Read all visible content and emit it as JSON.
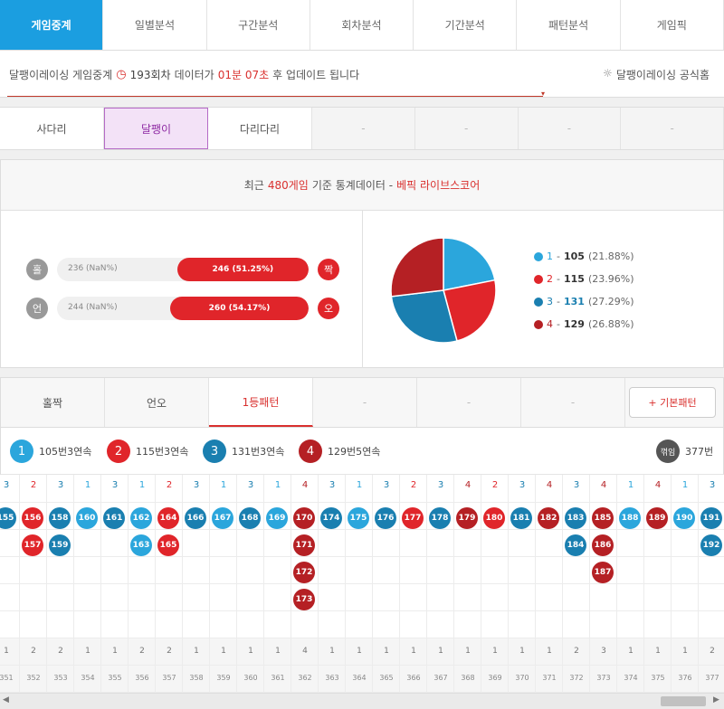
{
  "topnav": {
    "tabs": [
      "게임중계",
      "일별분석",
      "구간분석",
      "회차분석",
      "기간분석",
      "패턴분석",
      "게임픽"
    ],
    "active": 0
  },
  "info": {
    "prefix": "달팽이레이싱 게임중계",
    "round": "193회차",
    "mid": "데이터가",
    "time": "01분 07초",
    "suffix": "후 업데이트 됩니다",
    "official": "달팽이레이싱 공식홈"
  },
  "subnav": {
    "tabs": [
      "사다리",
      "달팽이",
      "다리다리",
      "-",
      "-",
      "-",
      "-"
    ],
    "active": 1
  },
  "stats": {
    "head_prefix": "최근",
    "games": "480게임",
    "head_mid": "기준 통계데이터 -",
    "brand": "베픽 라이브스코어",
    "rows": [
      {
        "left_badge": "홀",
        "left_text": "236 (NaN%)",
        "right_text": "246 (51.25%)",
        "right_badge": "짝",
        "fill_pct": 51.25
      },
      {
        "left_badge": "언",
        "left_text": "244 (NaN%)",
        "right_text": "260 (54.17%)",
        "right_badge": "오",
        "fill_pct": 54.17
      }
    ],
    "pie": [
      {
        "label": "1",
        "count": "105",
        "pct": "(21.88%)",
        "value": 21.88,
        "color": "#2ba6dc"
      },
      {
        "label": "2",
        "count": "115",
        "pct": "(23.96%)",
        "value": 23.96,
        "color": "#e0252a"
      },
      {
        "label": "3",
        "count": "131",
        "pct": "(27.29%)",
        "value": 27.29,
        "color": "#1a7fb0"
      },
      {
        "label": "4",
        "count": "129",
        "pct": "(26.88%)",
        "value": 26.88,
        "color": "#b52024"
      }
    ]
  },
  "ptabs": {
    "tabs": [
      "홀짝",
      "언오",
      "1등패턴",
      "-",
      "-",
      "-"
    ],
    "active": 2,
    "basic": "+ 기본패턴"
  },
  "summary": [
    {
      "num": "1",
      "text": "105번3연속",
      "cls": "b1"
    },
    {
      "num": "2",
      "text": "115번3연속",
      "cls": "b2"
    },
    {
      "num": "3",
      "text": "131번3연속",
      "cls": "b3"
    },
    {
      "num": "4",
      "text": "129번5연속",
      "cls": "b4"
    },
    {
      "num": "꺾임",
      "text": "377번",
      "cls": "bk"
    }
  ],
  "colors": {
    "1": "#2ba6dc",
    "2": "#e0252a",
    "3": "#1a7fb0",
    "4": "#b52024"
  },
  "pattern": [
    {
      "winner": "3",
      "balls": [
        "155"
      ],
      "count": "1",
      "round": "351"
    },
    {
      "winner": "2",
      "balls": [
        "156",
        "157"
      ],
      "count": "2",
      "round": "352"
    },
    {
      "winner": "3",
      "balls": [
        "158",
        "159"
      ],
      "count": "2",
      "round": "353"
    },
    {
      "winner": "1",
      "balls": [
        "160"
      ],
      "count": "1",
      "round": "354"
    },
    {
      "winner": "3",
      "balls": [
        "161"
      ],
      "count": "1",
      "round": "355"
    },
    {
      "winner": "1",
      "balls": [
        "162",
        "163"
      ],
      "count": "2",
      "round": "356"
    },
    {
      "winner": "2",
      "balls": [
        "164",
        "165"
      ],
      "count": "2",
      "round": "357"
    },
    {
      "winner": "3",
      "balls": [
        "166"
      ],
      "count": "1",
      "round": "358"
    },
    {
      "winner": "1",
      "balls": [
        "167"
      ],
      "count": "1",
      "round": "359"
    },
    {
      "winner": "3",
      "balls": [
        "168"
      ],
      "count": "1",
      "round": "360"
    },
    {
      "winner": "1",
      "balls": [
        "169"
      ],
      "count": "1",
      "round": "361"
    },
    {
      "winner": "4",
      "balls": [
        "170",
        "171",
        "172",
        "173"
      ],
      "count": "4",
      "round": "362"
    },
    {
      "winner": "3",
      "balls": [
        "174"
      ],
      "count": "1",
      "round": "363"
    },
    {
      "winner": "1",
      "balls": [
        "175"
      ],
      "count": "1",
      "round": "364"
    },
    {
      "winner": "3",
      "balls": [
        "176"
      ],
      "count": "1",
      "round": "365"
    },
    {
      "winner": "2",
      "balls": [
        "177"
      ],
      "count": "1",
      "round": "366"
    },
    {
      "winner": "3",
      "balls": [
        "178"
      ],
      "count": "1",
      "round": "367"
    },
    {
      "winner": "4",
      "balls": [
        "179"
      ],
      "count": "1",
      "round": "368"
    },
    {
      "winner": "2",
      "balls": [
        "180"
      ],
      "count": "1",
      "round": "369"
    },
    {
      "winner": "3",
      "balls": [
        "181"
      ],
      "count": "1",
      "round": "370"
    },
    {
      "winner": "4",
      "balls": [
        "182"
      ],
      "count": "1",
      "round": "371"
    },
    {
      "winner": "3",
      "balls": [
        "183",
        "184"
      ],
      "count": "2",
      "round": "372"
    },
    {
      "winner": "4",
      "balls": [
        "185",
        "186",
        "187"
      ],
      "count": "3",
      "round": "373"
    },
    {
      "winner": "1",
      "balls": [
        "188"
      ],
      "count": "1",
      "round": "374"
    },
    {
      "winner": "4",
      "balls": [
        "189"
      ],
      "count": "1",
      "round": "375"
    },
    {
      "winner": "1",
      "balls": [
        "190"
      ],
      "count": "1",
      "round": "376"
    },
    {
      "winner": "3",
      "balls": [
        "191",
        "192"
      ],
      "count": "2",
      "round": "377"
    }
  ]
}
